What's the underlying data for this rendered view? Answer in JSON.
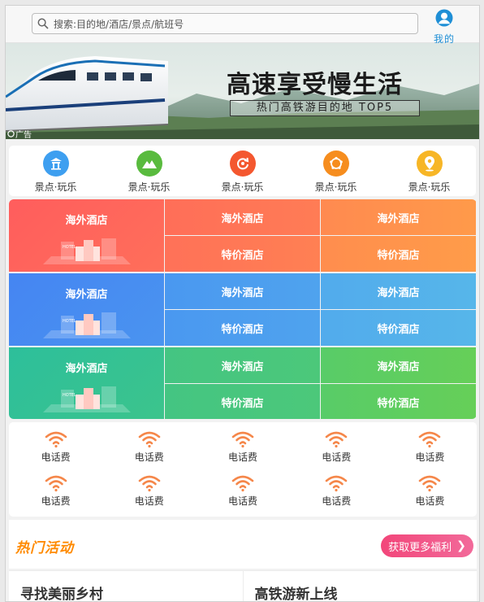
{
  "search": {
    "placeholder": "搜索:目的地/酒店/景点/航班号"
  },
  "profile": {
    "label": "我的",
    "icon": "user-icon"
  },
  "banner": {
    "title": "高速享受慢生活",
    "subtitle": "热门高铁游目的地 TOP5",
    "ad_label": "广告"
  },
  "quick_nav": [
    {
      "label": "景点·玩乐",
      "icon": "pavilion-icon",
      "color": "#3e9ff0"
    },
    {
      "label": "景点·玩乐",
      "icon": "mountain-icon",
      "color": "#59bb3e"
    },
    {
      "label": "景点·玩乐",
      "icon": "refresh-icon",
      "color": "#f4572f"
    },
    {
      "label": "景点·玩乐",
      "icon": "wheel-icon",
      "color": "#f68d1e"
    },
    {
      "label": "景点·玩乐",
      "icon": "location-pin-icon",
      "color": "#f7b626"
    }
  ],
  "hotel_grid": [
    {
      "main": "海外酒店",
      "top": [
        "海外酒店",
        "海外酒店"
      ],
      "bottom": [
        "特价酒店",
        "特价酒店"
      ],
      "colors": [
        "#ff5d5d",
        "#ff7a56",
        "#ff9a4a"
      ]
    },
    {
      "main": "海外酒店",
      "top": [
        "海外酒店",
        "海外酒店"
      ],
      "bottom": [
        "特价酒店",
        "特价酒店"
      ],
      "colors": [
        "#4a8cf2",
        "#4aa3ee",
        "#55b6ea"
      ]
    },
    {
      "main": "海外酒店",
      "top": [
        "海外酒店",
        "海外酒店"
      ],
      "bottom": [
        "特价酒店",
        "特价酒店"
      ],
      "colors": [
        "#2fc09a",
        "#48c77c",
        "#66cf58"
      ]
    }
  ],
  "services": {
    "icon": "wifi-icon",
    "color": "#f5874a",
    "rows": [
      [
        "电话费",
        "电话费",
        "电话费",
        "电话费",
        "电话费"
      ],
      [
        "电话费",
        "电话费",
        "电话费",
        "电话费",
        "电话费"
      ]
    ]
  },
  "activities": {
    "title": "热门活动",
    "more_label": "获取更多福利"
  },
  "bottom_cards": [
    "寻找美丽乡村",
    "高铁游新上线"
  ]
}
